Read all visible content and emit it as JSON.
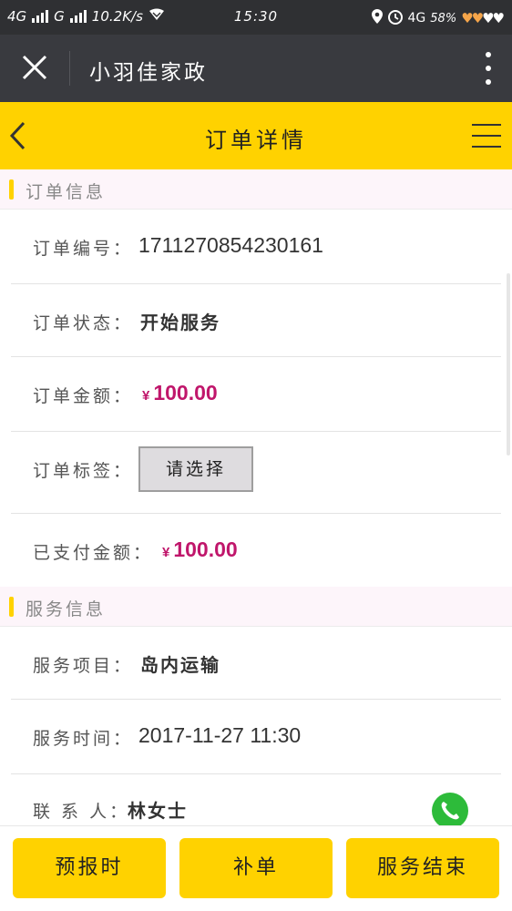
{
  "status_bar": {
    "network1": "4G",
    "network2": "G",
    "speed": "10.2K/s",
    "time": "15:30",
    "network3": "4G",
    "battery": "58%"
  },
  "title_bar": {
    "title": "小羽佳家政"
  },
  "header": {
    "title": "订单详情"
  },
  "order_section": {
    "title": "订单信息",
    "number_label": "订单编号：",
    "number_value": "1711270854230161",
    "status_label": "订单状态：",
    "status_value": "开始服务",
    "amount_label": "订单金额：",
    "amount_currency": "¥",
    "amount_value": "100.00",
    "tag_label": "订单标签：",
    "tag_select": "请选择",
    "paid_label": "已支付金额：",
    "paid_currency": "¥",
    "paid_value": "100.00"
  },
  "service_section": {
    "title": "服务信息",
    "item_label": "服务项目：",
    "item_value": "岛内运输",
    "time_label": "服务时间：",
    "time_value": "2017-11-27 11:30",
    "contact_label": "联 系 人：",
    "contact_value": "林女士"
  },
  "bottom": {
    "btn1": "预报时",
    "btn2": "补单",
    "btn3": "服务结束"
  },
  "colors": {
    "accent": "#ffd200",
    "money": "#c0166b",
    "titlebar": "#393a3f",
    "call": "#2dbb3a"
  },
  "icons": {
    "close": "close-icon",
    "more": "more-vertical-icon",
    "back": "chevron-left-icon",
    "menu": "menu-icon",
    "phone": "phone-icon"
  }
}
